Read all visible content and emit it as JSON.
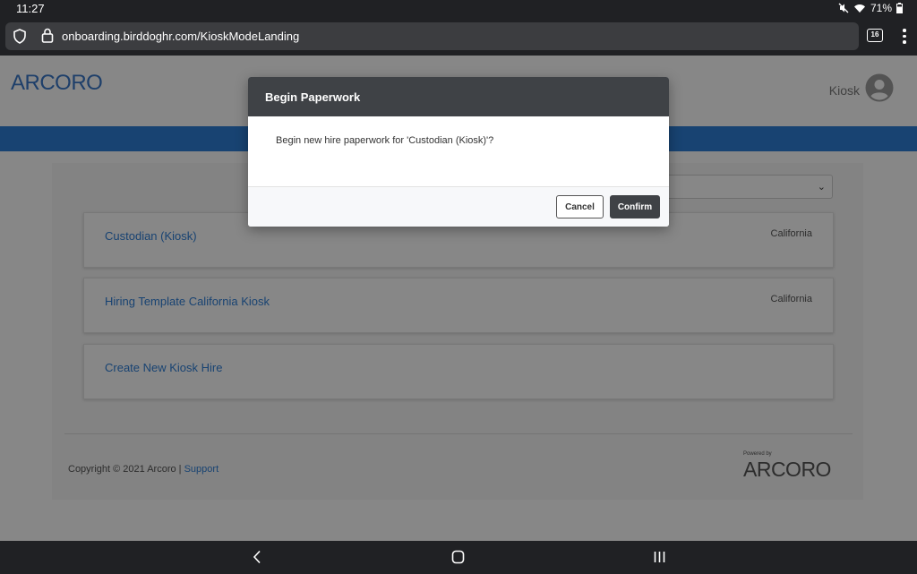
{
  "status_bar": {
    "time": "11:27",
    "battery": "71%"
  },
  "browser": {
    "url": "onboarding.birddoghr.com/KioskModeLanding",
    "tab_count": "16"
  },
  "header": {
    "logo_text": "ARCORO",
    "user_label": "Kiosk"
  },
  "cards": [
    {
      "title": "Custodian (Kiosk)",
      "state": "California"
    },
    {
      "title": "Hiring Template California Kiosk",
      "state": "California"
    },
    {
      "title": "Create New Kiosk Hire",
      "state": ""
    }
  ],
  "footer": {
    "copyright": "Copyright © 2021 Arcoro | ",
    "support_link": "Support",
    "powered_by": "Powered by",
    "powered_logo": "ARCORO"
  },
  "modal": {
    "title": "Begin Paperwork",
    "message": "Begin new hire paperwork for 'Custodian (Kiosk)'?",
    "cancel_label": "Cancel",
    "confirm_label": "Confirm"
  },
  "colors": {
    "accent": "#2f7fd8",
    "modal_header": "#3f4246",
    "logo": "#3a78c9"
  }
}
